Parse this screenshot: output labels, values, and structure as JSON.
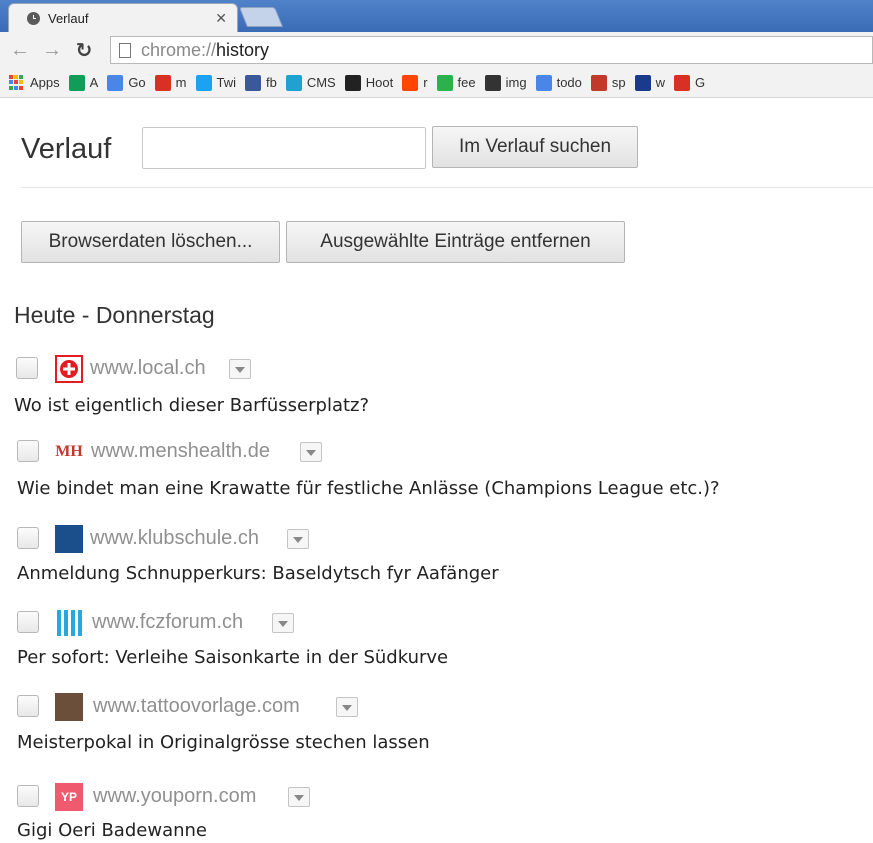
{
  "browser": {
    "tab_title": "Verlauf",
    "tab_close": "✕",
    "url_scheme": "chrome://",
    "url_host": "history"
  },
  "bookmarks": [
    {
      "label": "Apps",
      "icon": "apps-grid-icon"
    },
    {
      "label": "A",
      "icon": "sheets-icon",
      "color": "#0f9d58"
    },
    {
      "label": "Go",
      "icon": "google-icon",
      "color": "#4a86e8"
    },
    {
      "label": "m",
      "icon": "gmail-icon",
      "color": "#d93025"
    },
    {
      "label": "Twi",
      "icon": "twitter-icon",
      "color": "#1da1f2"
    },
    {
      "label": "fb",
      "icon": "facebook-icon",
      "color": "#3b5998"
    },
    {
      "label": "CMS",
      "icon": "wordpress-icon",
      "color": "#21a0d2"
    },
    {
      "label": "Hoot",
      "icon": "hootsuite-owl-icon",
      "color": "#222222"
    },
    {
      "label": "r",
      "icon": "reddit-icon",
      "color": "#ff4500"
    },
    {
      "label": "fee",
      "icon": "feedly-icon",
      "color": "#2bb24c"
    },
    {
      "label": "img",
      "icon": "img-icon",
      "color": "#333333"
    },
    {
      "label": "todo",
      "icon": "google-icon",
      "color": "#4a86e8"
    },
    {
      "label": "sp",
      "icon": "spiegel-online-icon",
      "color": "#c0392b"
    },
    {
      "label": "w",
      "icon": "word-icon",
      "color": "#1a3a8c"
    },
    {
      "label": "G",
      "icon": "g-icon",
      "color": "#d93025"
    }
  ],
  "page": {
    "title": "Verlauf",
    "search_value": "",
    "search_button": "Im Verlauf suchen",
    "clear_button": "Browserdaten löschen...",
    "remove_button": "Ausgewählte Einträge entfernen",
    "day_heading": "Heute - Donnerstag"
  },
  "entries": [
    {
      "domain": "www.local.ch",
      "title": "Wo ist eigentlich dieser Barfüsserplatz?",
      "icon": "local-ch-icon"
    },
    {
      "domain": "www.menshealth.de",
      "title": "Wie bindet man eine Krawatte für festliche Anlässe (Champions League etc.)?",
      "icon": "menshealth-icon",
      "icon_text": "MH"
    },
    {
      "domain": "www.klubschule.ch",
      "title": "Anmeldung Schnupperkurs: Baseldytsch fyr Aafänger",
      "icon": "klubschule-icon"
    },
    {
      "domain": "www.fczforum.ch",
      "title": "Per sofort: Verleihe Saisonkarte in der Südkurve",
      "icon": "fczforum-stripes-icon"
    },
    {
      "domain": "www.tattoovorlage.com",
      "title": "Meisterpokal in Originalgrösse stechen lassen",
      "icon": "tattoovorlage-icon"
    },
    {
      "domain": "www.youporn.com",
      "title": "Gigi Oeri Badewanne",
      "icon": "youporn-icon",
      "icon_text": "YP"
    }
  ]
}
